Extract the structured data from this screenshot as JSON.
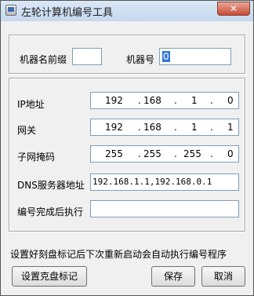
{
  "window": {
    "title": "左轮计算机编号工具",
    "close_label": "✕"
  },
  "fields": {
    "prefix_label": "机器名前缀",
    "prefix_value": "",
    "number_label": "机器号",
    "number_value": "0",
    "ip_label": "IP地址",
    "ip": [
      "192",
      "168",
      "1",
      "0"
    ],
    "gateway_label": "网关",
    "gateway": [
      "192",
      "168",
      "1",
      "1"
    ],
    "mask_label": "子网掩码",
    "mask": [
      "255",
      "255",
      "255",
      "0"
    ],
    "dns_label": "DNS服务器地址",
    "dns_value": "192.168.1.1,192.168.0.1",
    "after_label": "编号完成后执行",
    "after_value": ""
  },
  "notice": "设置好刻盘标记后下次重新启动会自动执行编号程序",
  "buttons": {
    "mark": "设置克盘标记",
    "save": "保存",
    "cancel": "取消"
  },
  "ip_dot": "."
}
